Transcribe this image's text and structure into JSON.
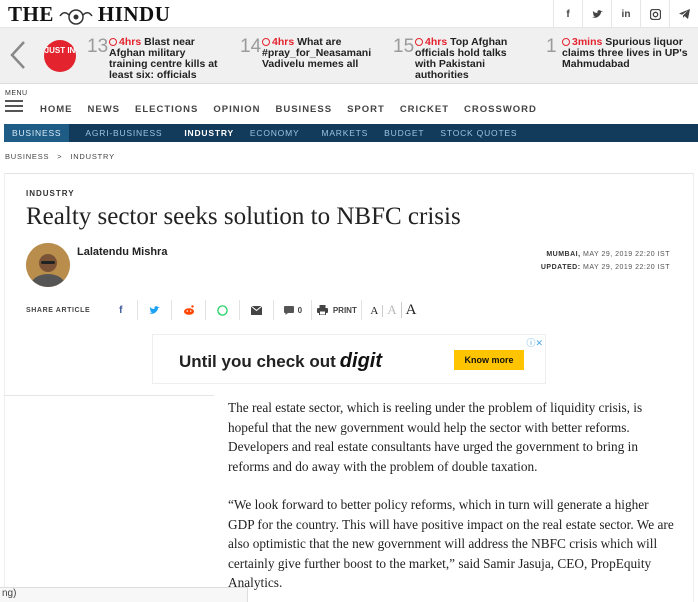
{
  "header": {
    "logo_left": "THE",
    "logo_right": "HINDU",
    "social": [
      "f",
      "✓",
      "in",
      "▣",
      "✓"
    ]
  },
  "ticker": {
    "just_in": "JUST IN",
    "items": [
      {
        "num": "13",
        "time": "4hrs",
        "text": "Blast near Afghan military training centre kills at least six: officials"
      },
      {
        "num": "14",
        "time": "4hrs",
        "text": "What are #pray_for_Neasamani Vadivelu memes all"
      },
      {
        "num": "15",
        "time": "4hrs",
        "text": "Top Afghan officials hold talks with Pakistani authorities"
      },
      {
        "num": "1",
        "time": "3mins",
        "text": "Spurious liquor claims three lives in UP's Mahmudabad"
      }
    ]
  },
  "menu": {
    "label": "MENU",
    "links": [
      "HOME",
      "NEWS",
      "ELECTIONS",
      "OPINION",
      "BUSINESS",
      "SPORT",
      "CRICKET",
      "CROSSWORD"
    ]
  },
  "subnav": [
    "BUSINESS",
    "AGRI-BUSINESS",
    "INDUSTRY",
    "ECONOMY",
    "MARKETS",
    "BUDGET",
    "STOCK QUOTES"
  ],
  "breadcrumb": {
    "parent": "BUSINESS",
    "sep": ">",
    "current": "INDUSTRY"
  },
  "article": {
    "section": "INDUSTRY",
    "headline": "Realty sector seeks solution to NBFC crisis",
    "author": "Lalatendu Mishra",
    "place": "MUMBAI,",
    "date": "MAY 29, 2019 22:20 IST",
    "updated_label": "UPDATED:",
    "updated": "MAY 29, 2019 22:20 IST",
    "share_label": "SHARE ARTICLE",
    "comment_count": "0",
    "print_label": "PRINT",
    "font_sizes": [
      "A",
      "A",
      "A"
    ],
    "paragraphs": [
      "The real estate sector, which is reeling under the problem of liquidity crisis, is hopeful that the new government would help the sector with better reforms. Developers and real estate consultants have urged the government to bring in reforms and do away with the problem of double taxation.",
      "“We look forward to better policy reforms, which in turn will generate a higher GDP for the country. This will have positive impact on the real estate sector. We are also optimistic that the new government will address the NBFC crisis which will certainly give further boost to the market,” said Samir Jasuja, CEO, PropEquity Analytics."
    ]
  },
  "ad": {
    "text": "Until you check out",
    "brand": "digit",
    "button": "Know more",
    "close": "ⓘ✕"
  },
  "status_fragment": "ng)",
  "colors": {
    "navy": "#123a5a",
    "red": "#e3232e",
    "ad_button": "#ffc400"
  }
}
